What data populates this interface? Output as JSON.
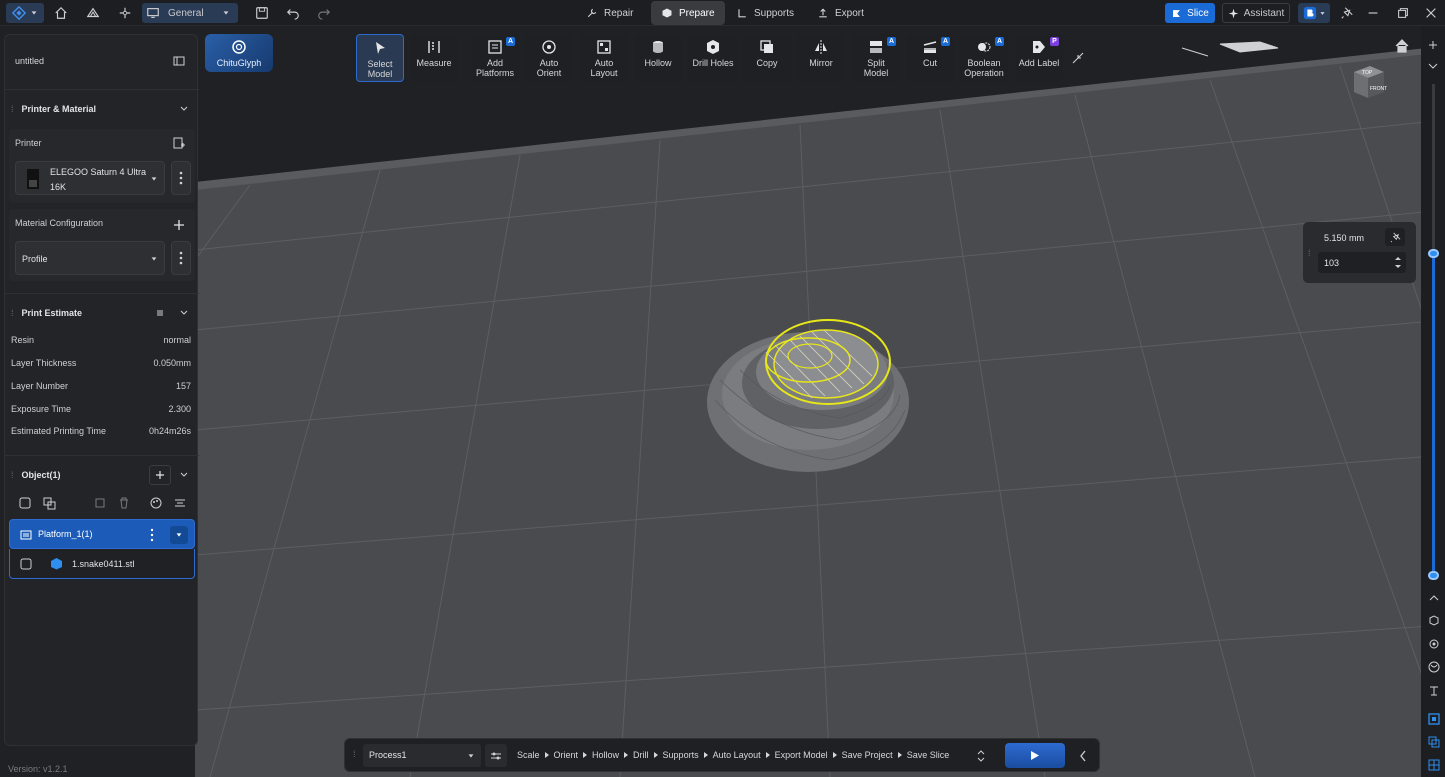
{
  "topbar": {
    "workspace_label": "General",
    "modes": [
      {
        "label": "Repair"
      },
      {
        "label": "Prepare"
      },
      {
        "label": "Supports"
      },
      {
        "label": "Export"
      }
    ],
    "slice_label": "Slice",
    "assistant_label": "Assistant"
  },
  "chitu_label": "ChituGlyph",
  "toolbar": [
    {
      "label": "Select\nModel",
      "icon": "cursor-icon"
    },
    {
      "label": "Measure",
      "icon": "ruler-icon"
    },
    {
      "label": "Add\nPlatforms",
      "icon": "add-platform-icon",
      "badge": "A"
    },
    {
      "label": "Auto\nOrient",
      "icon": "orient-icon"
    },
    {
      "label": "Auto\nLayout",
      "icon": "layout-icon"
    },
    {
      "label": "Hollow",
      "icon": "hollow-icon"
    },
    {
      "label": "Drill Holes",
      "icon": "drill-icon"
    },
    {
      "label": "Copy",
      "icon": "copy-icon"
    },
    {
      "label": "Mirror",
      "icon": "mirror-icon"
    },
    {
      "label": "Split\nModel",
      "icon": "split-icon",
      "badge": "A"
    },
    {
      "label": "Cut",
      "icon": "cut-icon",
      "badge": "A"
    },
    {
      "label": "Boolean\nOperation",
      "icon": "boolean-icon",
      "badge": "A"
    },
    {
      "label": "Add Label",
      "icon": "label-icon",
      "badge": "P"
    }
  ],
  "left_panel": {
    "project_name": "untitled",
    "printer_material_title": "Printer & Material",
    "printer_label": "Printer",
    "printer_name_line1": "ELEGOO Saturn 4 Ultra",
    "printer_name_line2": "16K",
    "material_config_label": "Material Configuration",
    "profile_label": "Profile",
    "print_estimate_title": "Print Estimate",
    "estimates": [
      {
        "label": "Resin",
        "value": "normal"
      },
      {
        "label": "Layer Thickness",
        "value": "0.050mm"
      },
      {
        "label": "Layer Number",
        "value": "157"
      },
      {
        "label": "Exposure Time",
        "value": "2.300"
      },
      {
        "label": "Estimated Printing Time",
        "value": "0h24m26s"
      }
    ],
    "objects_title": "Object(1)",
    "platform_label": "Platform_1(1)",
    "file_label": "1.snake0411.stl"
  },
  "layer_panel": {
    "height": "5.150 mm",
    "layer": "103"
  },
  "bottombar": {
    "process": "Process1",
    "steps": [
      "Scale",
      "Orient",
      "Hollow",
      "Drill",
      "Supports",
      "Auto Layout",
      "Export Model",
      "Save Project",
      "Save Slice"
    ]
  },
  "version": "Version: v1.2.1",
  "nav_cube": {
    "top": "TOP",
    "front": "FRONT"
  },
  "colors": {
    "accent": "#1a6bd6",
    "highlight": "#e6e61a",
    "model": "#6e7073"
  }
}
